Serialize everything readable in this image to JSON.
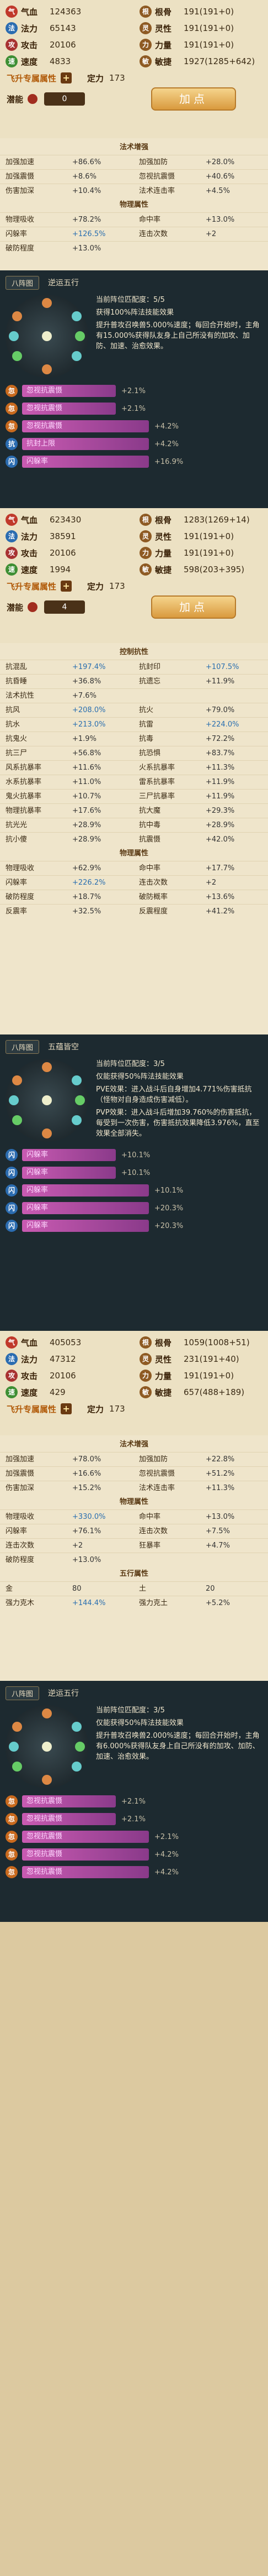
{
  "block1": {
    "stats": [
      {
        "l": {
          "icon": "气",
          "color": "#c0392b",
          "label": "气血",
          "value": "124363"
        },
        "r": {
          "icon": "根",
          "color": "#8e5a23",
          "label": "根骨",
          "value": "191(191+0)"
        }
      },
      {
        "l": {
          "icon": "法",
          "color": "#2b6cb0",
          "label": "法力",
          "value": "65143"
        },
        "r": {
          "icon": "灵",
          "color": "#8e5a23",
          "label": "灵性",
          "value": "191(191+0)"
        }
      },
      {
        "l": {
          "icon": "攻",
          "color": "#a83232",
          "label": "攻击",
          "value": "20106"
        },
        "r": {
          "icon": "力",
          "color": "#8e5a23",
          "label": "力量",
          "value": "191(191+0)"
        }
      },
      {
        "l": {
          "icon": "速",
          "color": "#3e8f34",
          "label": "速度",
          "value": "4833"
        },
        "r": {
          "icon": "敏",
          "color": "#8e5a23",
          "label": "敏捷",
          "value": "1927(1285+642)"
        }
      }
    ],
    "fly": {
      "label": "飞升专属属性",
      "ding_label": "定力",
      "ding_value": "173"
    },
    "potential": {
      "label": "潜能",
      "value": "0",
      "button": "加点"
    },
    "tables": [
      {
        "title": "法术增强",
        "rows": [
          [
            "加强加速",
            "+86.6%",
            "加强加防",
            "+28.0%"
          ],
          [
            "加强震慑",
            "+8.6%",
            "忽视抗震慑",
            "+40.6%"
          ],
          [
            "伤害加深",
            "+10.4%",
            "法术连击率",
            "+4.5%"
          ]
        ]
      },
      {
        "title": "物理属性",
        "rows": [
          [
            "物理吸收",
            "+78.2%",
            "命中率",
            "+13.0%"
          ],
          [
            "闪躲率",
            "+126.5%",
            "连击次数",
            "+2"
          ],
          [
            "破防程度",
            "+13.0%",
            "",
            ""
          ]
        ]
      }
    ]
  },
  "block2": {
    "tab": "八阵图",
    "title": "逆运五行",
    "text": [
      "当前阵位匹配度：5/5",
      "获得100%阵法技能效果",
      "提升普攻召唤兽5.000%速度；每回合开始时，主角有15.000%获得队友身上自己所没有的加攻、加防、加速、治愈效果。"
    ],
    "buffs": [
      {
        "icon": "忽",
        "color": "#c96a1e",
        "label": "忽视抗震慑",
        "value": "+2.1%"
      },
      {
        "icon": "忽",
        "color": "#c96a1e",
        "label": "忽视抗震慑",
        "value": "+2.1%"
      },
      {
        "icon": "忽",
        "color": "#c96a1e",
        "label": "忽视抗震慑",
        "value": "+4.2%"
      },
      {
        "icon": "抗",
        "color": "#2b6cb0",
        "label": "抗封上限",
        "value": "+4.2%"
      },
      {
        "icon": "闪",
        "color": "#2b6cb0",
        "label": "闪躲率",
        "value": "+16.9%"
      }
    ]
  },
  "block3": {
    "stats": [
      {
        "l": {
          "icon": "气",
          "color": "#c0392b",
          "label": "气血",
          "value": "623430"
        },
        "r": {
          "icon": "根",
          "color": "#8e5a23",
          "label": "根骨",
          "value": "1283(1269+14)"
        }
      },
      {
        "l": {
          "icon": "法",
          "color": "#2b6cb0",
          "label": "法力",
          "value": "38591"
        },
        "r": {
          "icon": "灵",
          "color": "#8e5a23",
          "label": "灵性",
          "value": "191(191+0)"
        }
      },
      {
        "l": {
          "icon": "攻",
          "color": "#a83232",
          "label": "攻击",
          "value": "20106"
        },
        "r": {
          "icon": "力",
          "color": "#8e5a23",
          "label": "力量",
          "value": "191(191+0)"
        }
      },
      {
        "l": {
          "icon": "速",
          "color": "#3e8f34",
          "label": "速度",
          "value": "1994"
        },
        "r": {
          "icon": "敏",
          "color": "#8e5a23",
          "label": "敏捷",
          "value": "598(203+395)"
        }
      }
    ],
    "fly": {
      "label": "飞升专属属性",
      "ding_label": "定力",
      "ding_value": "173"
    },
    "potential": {
      "label": "潜能",
      "value": "4",
      "button": "加点"
    },
    "tables": [
      {
        "title": "控制抗性",
        "rows": [
          [
            "抗混乱",
            "+197.4%",
            "抗封印",
            "+107.5%"
          ],
          [
            "抗昏睡",
            "+36.8%",
            "抗遗忘",
            "+11.9%"
          ],
          [
            "法术抗性",
            "+7.6%",
            "",
            ""
          ],
          [
            "抗风",
            "+208.0%",
            "抗火",
            "+79.0%"
          ],
          [
            "抗水",
            "+213.0%",
            "抗雷",
            "+224.0%"
          ],
          [
            "抗鬼火",
            "+1.9%",
            "抗毒",
            "+72.2%"
          ],
          [
            "抗三尸",
            "+56.8%",
            "抗恐惧",
            "+83.7%"
          ],
          [
            "风系抗暴率",
            "+11.6%",
            "火系抗暴率",
            "+11.3%"
          ],
          [
            "水系抗暴率",
            "+11.0%",
            "雷系抗暴率",
            "+11.9%"
          ],
          [
            "鬼火抗暴率",
            "+10.7%",
            "三尸抗暴率",
            "+11.9%"
          ],
          [
            "物理抗暴率",
            "+17.6%",
            "抗大魔",
            "+29.3%"
          ],
          [
            "抗光光",
            "+28.9%",
            "抗中毒",
            "+28.9%"
          ],
          [
            "抗小傻",
            "+28.9%",
            "抗震慑",
            "+42.0%"
          ]
        ]
      },
      {
        "title": "物理属性",
        "rows": [
          [
            "物理吸收",
            "+62.9%",
            "命中率",
            "+17.7%"
          ],
          [
            "闪躲率",
            "+226.2%",
            "连击次数",
            "+2"
          ],
          [
            "破防程度",
            "+18.7%",
            "破防概率",
            "+13.6%"
          ],
          [
            "反震率",
            "+32.5%",
            "反震程度",
            "+41.2%"
          ]
        ]
      }
    ]
  },
  "block4": {
    "tab": "八阵图",
    "title": "五蕴皆空",
    "text": [
      "当前阵位匹配度：3/5",
      "仅能获得50%阵法技能效果",
      "PVE效果：进入战斗后自身增加4.771%伤害抵抗（怪物对自身造成伤害减低）。",
      "PVP效果：进入战斗后增加39.760%的伤害抵抗，每受到一次伤害，伤害抵抗效果降低3.976%，直至效果全部消失。"
    ],
    "buffs": [
      {
        "icon": "闪",
        "color": "#2b6cb0",
        "label": "闪躲率",
        "value": "+10.1%"
      },
      {
        "icon": "闪",
        "color": "#2b6cb0",
        "label": "闪躲率",
        "value": "+10.1%"
      },
      {
        "icon": "闪",
        "color": "#2b6cb0",
        "label": "闪躲率",
        "value": "+10.1%"
      },
      {
        "icon": "闪",
        "color": "#2b6cb0",
        "label": "闪躲率",
        "value": "+20.3%"
      },
      {
        "icon": "闪",
        "color": "#2b6cb0",
        "label": "闪躲率",
        "value": "+20.3%"
      }
    ]
  },
  "block5": {
    "stats": [
      {
        "l": {
          "icon": "气",
          "color": "#c0392b",
          "label": "气血",
          "value": "405053"
        },
        "r": {
          "icon": "根",
          "color": "#8e5a23",
          "label": "根骨",
          "value": "1059(1008+51)"
        }
      },
      {
        "l": {
          "icon": "法",
          "color": "#2b6cb0",
          "label": "法力",
          "value": "47312"
        },
        "r": {
          "icon": "灵",
          "color": "#8e5a23",
          "label": "灵性",
          "value": "231(191+40)"
        }
      },
      {
        "l": {
          "icon": "攻",
          "color": "#a83232",
          "label": "攻击",
          "value": "20106"
        },
        "r": {
          "icon": "力",
          "color": "#8e5a23",
          "label": "力量",
          "value": "191(191+0)"
        }
      },
      {
        "l": {
          "icon": "速",
          "color": "#3e8f34",
          "label": "速度",
          "value": "429"
        },
        "r": {
          "icon": "敏",
          "color": "#8e5a23",
          "label": "敏捷",
          "value": "657(488+189)"
        }
      }
    ],
    "fly": {
      "label": "飞升专属属性",
      "ding_label": "定力",
      "ding_value": "173"
    },
    "tables": [
      {
        "title": "法术增强",
        "rows": [
          [
            "加强加速",
            "+78.0%",
            "加强加防",
            "+22.8%"
          ],
          [
            "加强震慑",
            "+16.6%",
            "忽视抗震慑",
            "+51.2%"
          ],
          [
            "伤害加深",
            "+15.2%",
            "法术连击率",
            "+11.3%"
          ]
        ]
      },
      {
        "title": "物理属性",
        "rows": [
          [
            "物理吸收",
            "+330.0%",
            "命中率",
            "+13.0%"
          ],
          [
            "闪躲率",
            "+76.1%",
            "连击次数",
            "+7.5%"
          ],
          [
            "连击次数",
            "+2",
            "狂暴率",
            "+4.7%"
          ],
          [
            "破防程度",
            "+13.0%",
            "",
            ""
          ]
        ]
      },
      {
        "title": "五行属性",
        "rows": [
          [
            "金",
            "80",
            "土",
            "20"
          ],
          [
            "强力克木",
            "+144.4%",
            "强力克土",
            "+5.2%"
          ]
        ]
      }
    ]
  },
  "block6": {
    "tab": "八阵图",
    "title": "逆运五行",
    "text": [
      "当前阵位匹配度：3/5",
      "仅能获得50%阵法技能效果",
      "提升普攻召唤兽2.000%速度；每回合开始时，主角有6.000%获得队友身上自己所没有的加攻、加防、加速、治愈效果。"
    ],
    "buffs": [
      {
        "icon": "忽",
        "color": "#c96a1e",
        "label": "忽视抗震慑",
        "value": "+2.1%"
      },
      {
        "icon": "忽",
        "color": "#c96a1e",
        "label": "忽视抗震慑",
        "value": "+2.1%"
      },
      {
        "icon": "忽",
        "color": "#c96a1e",
        "label": "忽视抗震慑",
        "value": "+2.1%"
      },
      {
        "icon": "忽",
        "color": "#c96a1e",
        "label": "忽视抗震慑",
        "value": "+4.2%"
      },
      {
        "icon": "忽",
        "color": "#c96a1e",
        "label": "忽视抗震慑",
        "value": "+4.2%"
      }
    ]
  }
}
